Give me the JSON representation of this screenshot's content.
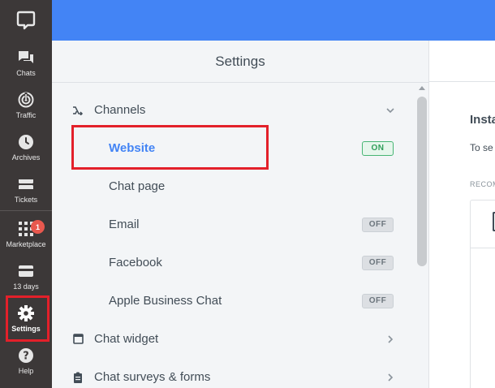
{
  "nav": {
    "items": [
      {
        "label": "Chats",
        "icon": "chats-icon"
      },
      {
        "label": "Traffic",
        "icon": "traffic-icon"
      },
      {
        "label": "Archives",
        "icon": "archives-icon"
      },
      {
        "label": "Tickets",
        "icon": "tickets-icon"
      },
      {
        "label": "Marketplace",
        "icon": "marketplace-icon",
        "badge": "1"
      },
      {
        "label": "13 days",
        "icon": "billing-icon"
      },
      {
        "label": "Settings",
        "icon": "gear-icon",
        "active": true
      },
      {
        "label": "Help",
        "icon": "help-icon"
      }
    ]
  },
  "settings": {
    "title": "Settings",
    "channels": {
      "label": "Channels",
      "items": [
        {
          "label": "Website",
          "toggle": "ON",
          "active": true
        },
        {
          "label": "Chat page",
          "toggle": ""
        },
        {
          "label": "Email",
          "toggle": "OFF"
        },
        {
          "label": "Facebook",
          "toggle": "OFF"
        },
        {
          "label": "Apple Business Chat",
          "toggle": "OFF"
        }
      ]
    },
    "chat_widget": {
      "label": "Chat widget"
    },
    "chat_surveys": {
      "label": "Chat surveys & forms"
    }
  },
  "content": {
    "title": "Insta",
    "subtitle": "To se",
    "recommended": "RECOM"
  },
  "colors": {
    "accent": "#4384f5",
    "nav_bg": "#3c3838",
    "highlight": "#e3202a",
    "toggle_on": "#47b574"
  }
}
